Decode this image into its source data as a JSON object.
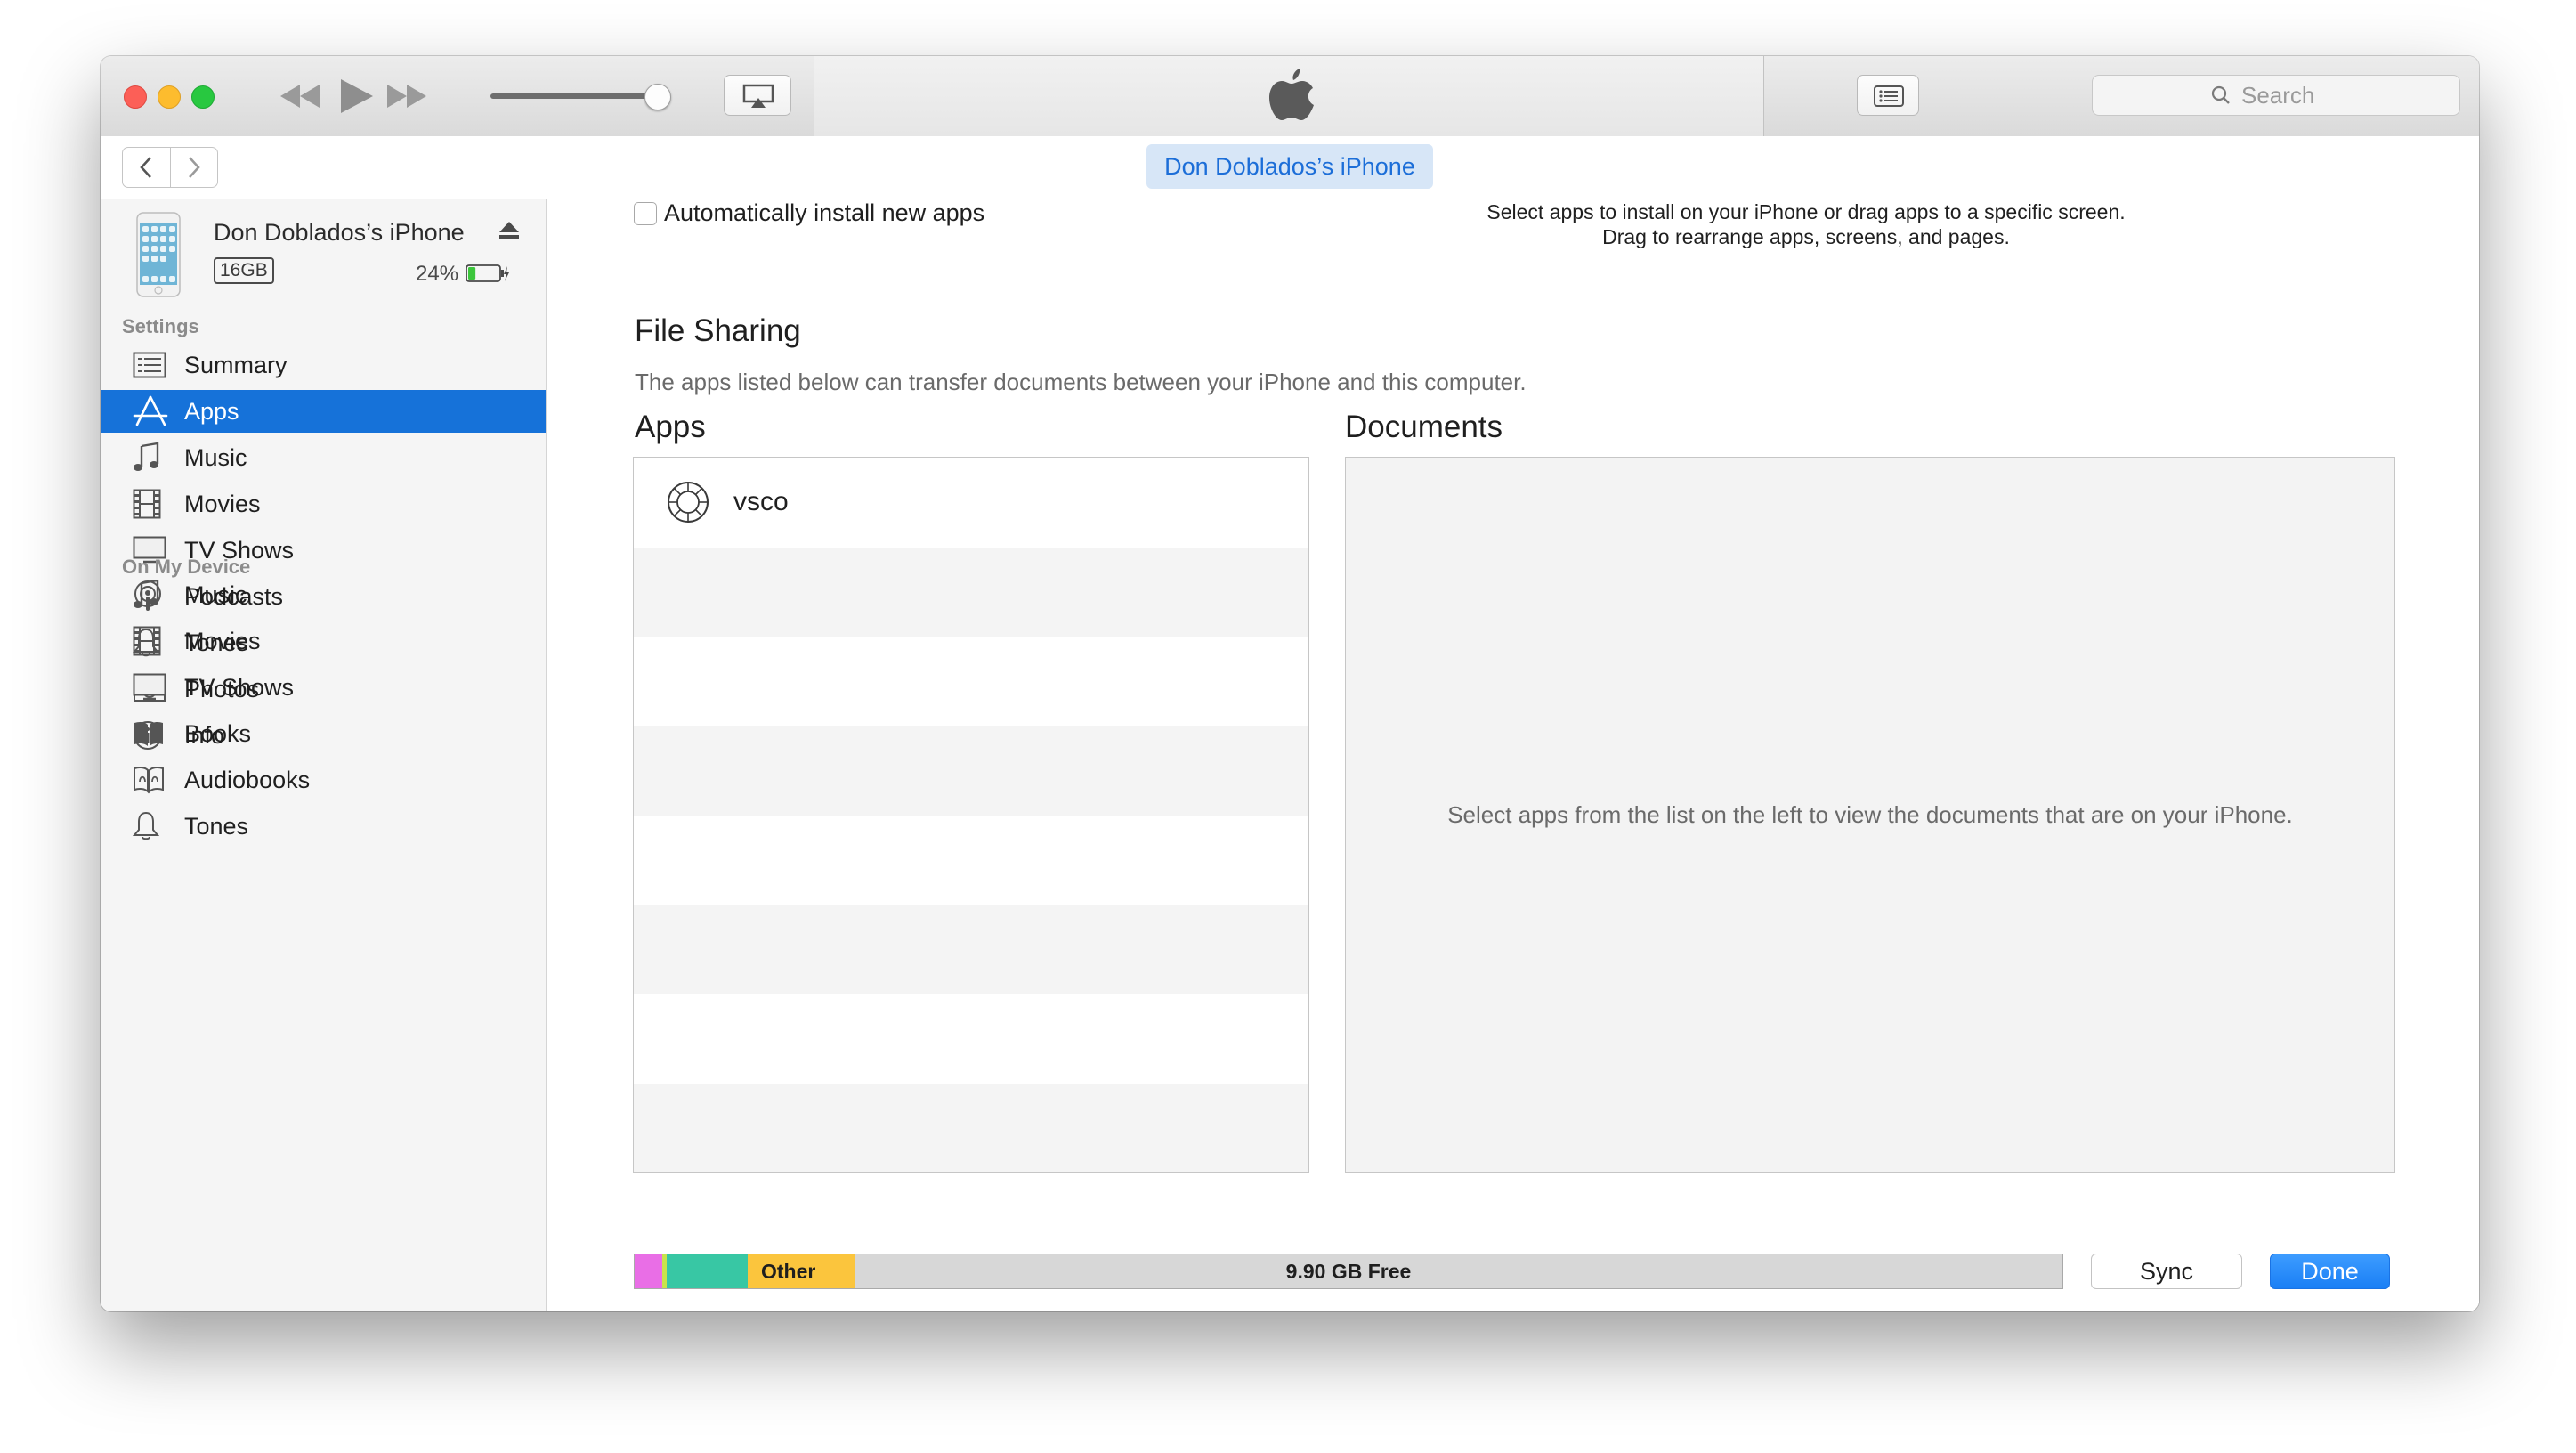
{
  "window": {
    "search_placeholder": "Search",
    "nav_title": "Don Doblados’s iPhone"
  },
  "device": {
    "name": "Don Doblados’s iPhone",
    "capacity": "16GB",
    "battery_percent": "24%",
    "battery_level": 0.24
  },
  "sidebar": {
    "settings_label": "Settings",
    "settings_items": [
      {
        "label": "Summary",
        "icon": "summary-icon"
      },
      {
        "label": "Apps",
        "icon": "apps-icon",
        "selected": true
      },
      {
        "label": "Music",
        "icon": "music-note-icon"
      },
      {
        "label": "Movies",
        "icon": "film-icon"
      },
      {
        "label": "TV Shows",
        "icon": "tv-icon"
      },
      {
        "label": "Podcasts",
        "icon": "podcast-icon"
      },
      {
        "label": "Tones",
        "icon": "bell-icon"
      },
      {
        "label": "Photos",
        "icon": "camera-icon"
      },
      {
        "label": "Info",
        "icon": "info-icon"
      }
    ],
    "device_label": "On My Device",
    "device_items": [
      {
        "label": "Music",
        "icon": "music-note-icon"
      },
      {
        "label": "Movies",
        "icon": "film-icon"
      },
      {
        "label": "TV Shows",
        "icon": "tv-icon"
      },
      {
        "label": "Books",
        "icon": "book-icon"
      },
      {
        "label": "Audiobooks",
        "icon": "audiobook-icon"
      },
      {
        "label": "Tones",
        "icon": "bell-icon"
      }
    ]
  },
  "main": {
    "auto_install_label": "Automatically install new apps",
    "hint_line1": "Select apps to install on your iPhone or drag apps to a specific screen.",
    "hint_line2": "Drag to rearrange apps, screens, and pages.",
    "file_sharing_title": "File Sharing",
    "file_sharing_desc": "The apps listed below can transfer documents between your iPhone and this computer.",
    "apps_title": "Apps",
    "documents_title": "Documents",
    "apps": [
      {
        "name": "vsco",
        "icon": "vsco-icon"
      }
    ],
    "documents_empty": "Select apps from the list on the left to view the documents that are on your iPhone."
  },
  "storage": {
    "other_label": "Other",
    "free_label": "9.90 GB Free",
    "colors": {
      "pink": "#e96ee6",
      "yellowgreen": "#c9e34b",
      "teal": "#38c7a4",
      "other": "#fbc53d",
      "free": "#d7d7d7"
    }
  },
  "buttons": {
    "sync": "Sync",
    "done": "Done"
  },
  "colors": {
    "accent": "#1672d9",
    "pill_bg": "#d7e6f7",
    "pill_text": "#1c6ed8"
  }
}
